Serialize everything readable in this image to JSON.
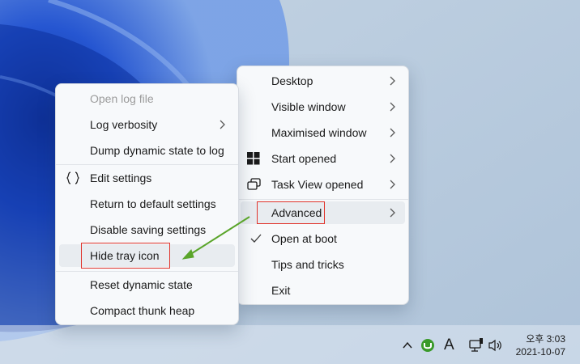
{
  "context_menu": {
    "items": [
      {
        "label": "Desktop"
      },
      {
        "label": "Visible window"
      },
      {
        "label": "Maximised window"
      },
      {
        "label": "Start opened"
      },
      {
        "label": "Task View opened"
      },
      {
        "label": "Advanced"
      },
      {
        "label": "Open at boot"
      },
      {
        "label": "Tips and tricks"
      },
      {
        "label": "Exit"
      }
    ]
  },
  "advanced_submenu": {
    "items": [
      {
        "label": "Open log file"
      },
      {
        "label": "Log verbosity"
      },
      {
        "label": "Dump dynamic state to log"
      },
      {
        "label": "Edit settings"
      },
      {
        "label": "Return to default settings"
      },
      {
        "label": "Disable saving settings"
      },
      {
        "label": "Hide tray icon"
      },
      {
        "label": "Reset dynamic state"
      },
      {
        "label": "Compact thunk heap"
      }
    ]
  },
  "taskbar": {
    "tray": {
      "keyboard_label": "A",
      "clock_time": "오후 3:03",
      "clock_date": "2021-10-07"
    }
  },
  "colors": {
    "annotation_box": "#e0332b",
    "annotation_arrow": "#5aa52a",
    "menu_background": "#f7f9fb",
    "highlight": "#e8ecf0"
  }
}
